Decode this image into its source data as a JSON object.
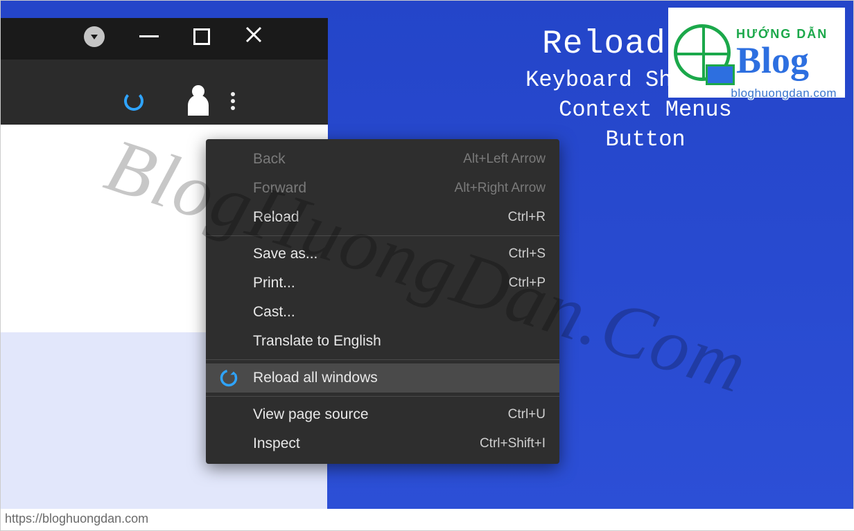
{
  "footer_url": "https://bloghuongdan.com",
  "headline": {
    "title": "Reload All",
    "line2": "Keyboard Shortcuts",
    "line3": "Context Menus",
    "line4": "Button"
  },
  "logo": {
    "line1": "HƯỚNG DẪN",
    "line2": "Blog",
    "url": "bloghuongdan.com"
  },
  "watermark": "BlogHuongDan.Com",
  "context_menu": [
    {
      "label": "Back",
      "shortcut": "Alt+Left Arrow",
      "disabled": true
    },
    {
      "label": "Forward",
      "shortcut": "Alt+Right Arrow",
      "disabled": true
    },
    {
      "label": "Reload",
      "shortcut": "Ctrl+R"
    },
    {
      "sep": true
    },
    {
      "label": "Save as...",
      "shortcut": "Ctrl+S"
    },
    {
      "label": "Print...",
      "shortcut": "Ctrl+P"
    },
    {
      "label": "Cast..."
    },
    {
      "label": "Translate to English"
    },
    {
      "sep": true
    },
    {
      "label": "Reload all windows",
      "highlight": true,
      "icon": "reload-ext-icon"
    },
    {
      "sep": true
    },
    {
      "label": "View page source",
      "shortcut": "Ctrl+U"
    },
    {
      "label": "Inspect",
      "shortcut": "Ctrl+Shift+I"
    }
  ]
}
